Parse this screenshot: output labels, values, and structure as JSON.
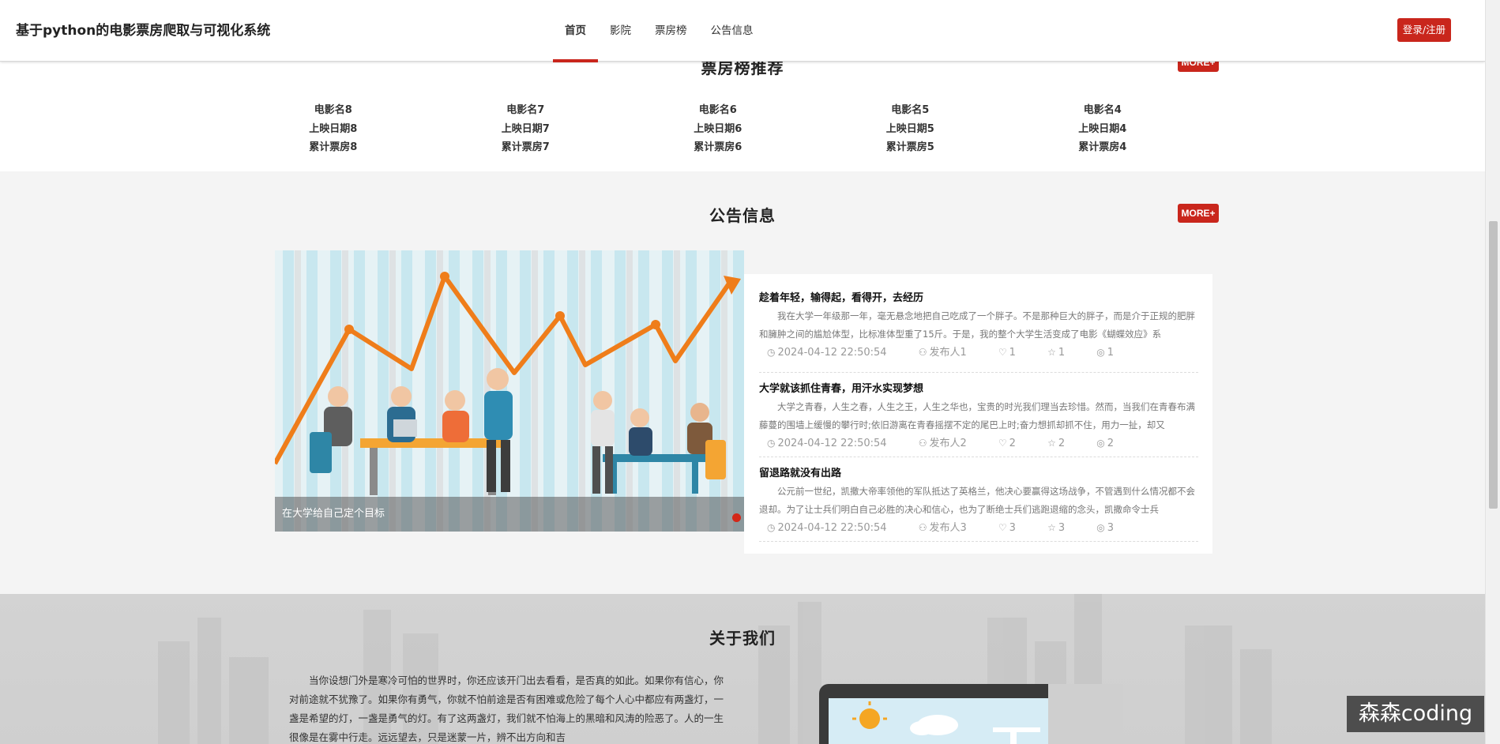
{
  "header": {
    "site_title": "基于python的电影票房爬取与可视化系统",
    "nav": [
      {
        "label": "首页",
        "active": true
      },
      {
        "label": "影院",
        "active": false
      },
      {
        "label": "票房榜",
        "active": false
      },
      {
        "label": "公告信息",
        "active": false
      }
    ],
    "login_label": "登录/注册"
  },
  "rank_section": {
    "title": "票房榜推荐",
    "more_label": "MORE+",
    "movies": [
      {
        "name": "电影名8",
        "date": "上映日期8",
        "box": "累计票房8"
      },
      {
        "name": "电影名7",
        "date": "上映日期7",
        "box": "累计票房7"
      },
      {
        "name": "电影名6",
        "date": "上映日期6",
        "box": "累计票房6"
      },
      {
        "name": "电影名5",
        "date": "上映日期5",
        "box": "累计票房5"
      },
      {
        "name": "电影名4",
        "date": "上映日期4",
        "box": "累计票房4"
      }
    ]
  },
  "notice_section": {
    "title": "公告信息",
    "more_label": "MORE+",
    "carousel_caption": "在大学给自己定个目标",
    "items": [
      {
        "title": "趁着年轻，输得起，看得开，去经历",
        "body": "我在大学一年级那一年，毫无悬念地把自己吃成了一个胖子。不是那种巨大的胖子，而是介于正规的肥胖和臃肿之间的尴尬体型，比标准体型重了15斤。于是，我的整个大学生活变成了电影《蝴蝶效应》系",
        "time": "2024-04-12 22:50:54",
        "author": "发布人1",
        "likes": "1",
        "favs": "1",
        "views": "1"
      },
      {
        "title": "大学就该抓住青春，用汗水实现梦想",
        "body": "大学之青春，人生之春，人生之王，人生之华也，宝贵的时光我们理当去珍惜。然而，当我们在青春布满藤蔓的围墙上缓慢的攀行时;依旧游离在青春摇摆不定的尾巴上时;奋力想抓却抓不住，用力一扯，却又",
        "time": "2024-04-12 22:50:54",
        "author": "发布人2",
        "likes": "2",
        "favs": "2",
        "views": "2"
      },
      {
        "title": "留退路就没有出路",
        "body": "公元前一世纪，凯撒大帝率领他的军队抵达了英格兰，他决心要赢得这场战争，不管遇到什么情况都不会退却。为了让士兵们明白自己必胜的决心和信心，也为了断绝士兵们逃跑退缩的念头，凯撒命令士兵",
        "time": "2024-04-12 22:50:54",
        "author": "发布人3",
        "likes": "3",
        "favs": "3",
        "views": "3"
      }
    ]
  },
  "about_section": {
    "title": "关于我们",
    "text": "当你设想门外是寒冷可怕的世界时，你还应该开门出去看看，是否真的如此。如果你有信心，你对前途就不犹豫了。如果你有勇气，你就不怕前途是否有困难或危险了每个人心中都应有两盏灯，一盏是希望的灯，一盏是勇气的灯。有了这两盏灯，我们就不怕海上的黑暗和风涛的险恶了。人的一生很像是在雾中行走。远远望去，只是迷蒙一片，辨不出方向和吉"
  },
  "watermark": "森森coding",
  "colors": {
    "accent": "#c9261c",
    "header_bg": "#ffffff",
    "page_bg": "#f4f4f4"
  }
}
